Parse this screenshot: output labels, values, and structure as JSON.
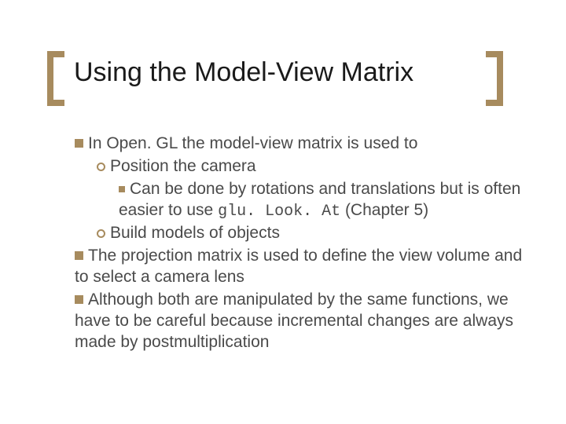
{
  "title": "Using the Model-View Matrix",
  "bullets": {
    "b1": "In Open. GL the model-view matrix is used to",
    "b1a": "Position the camera",
    "b1a1_pre": "Can be done by rotations and translations but is often easier to use ",
    "b1a1_code": "glu. Look. At",
    "b1a1_post": " (Chapter 5)",
    "b1b": "Build models of objects",
    "b2": "The projection matrix is used to define the view volume and to select a camera lens",
    "b3": "Although both are manipulated by the same functions, we have to be careful because incremental changes are always made by postmultiplication"
  }
}
